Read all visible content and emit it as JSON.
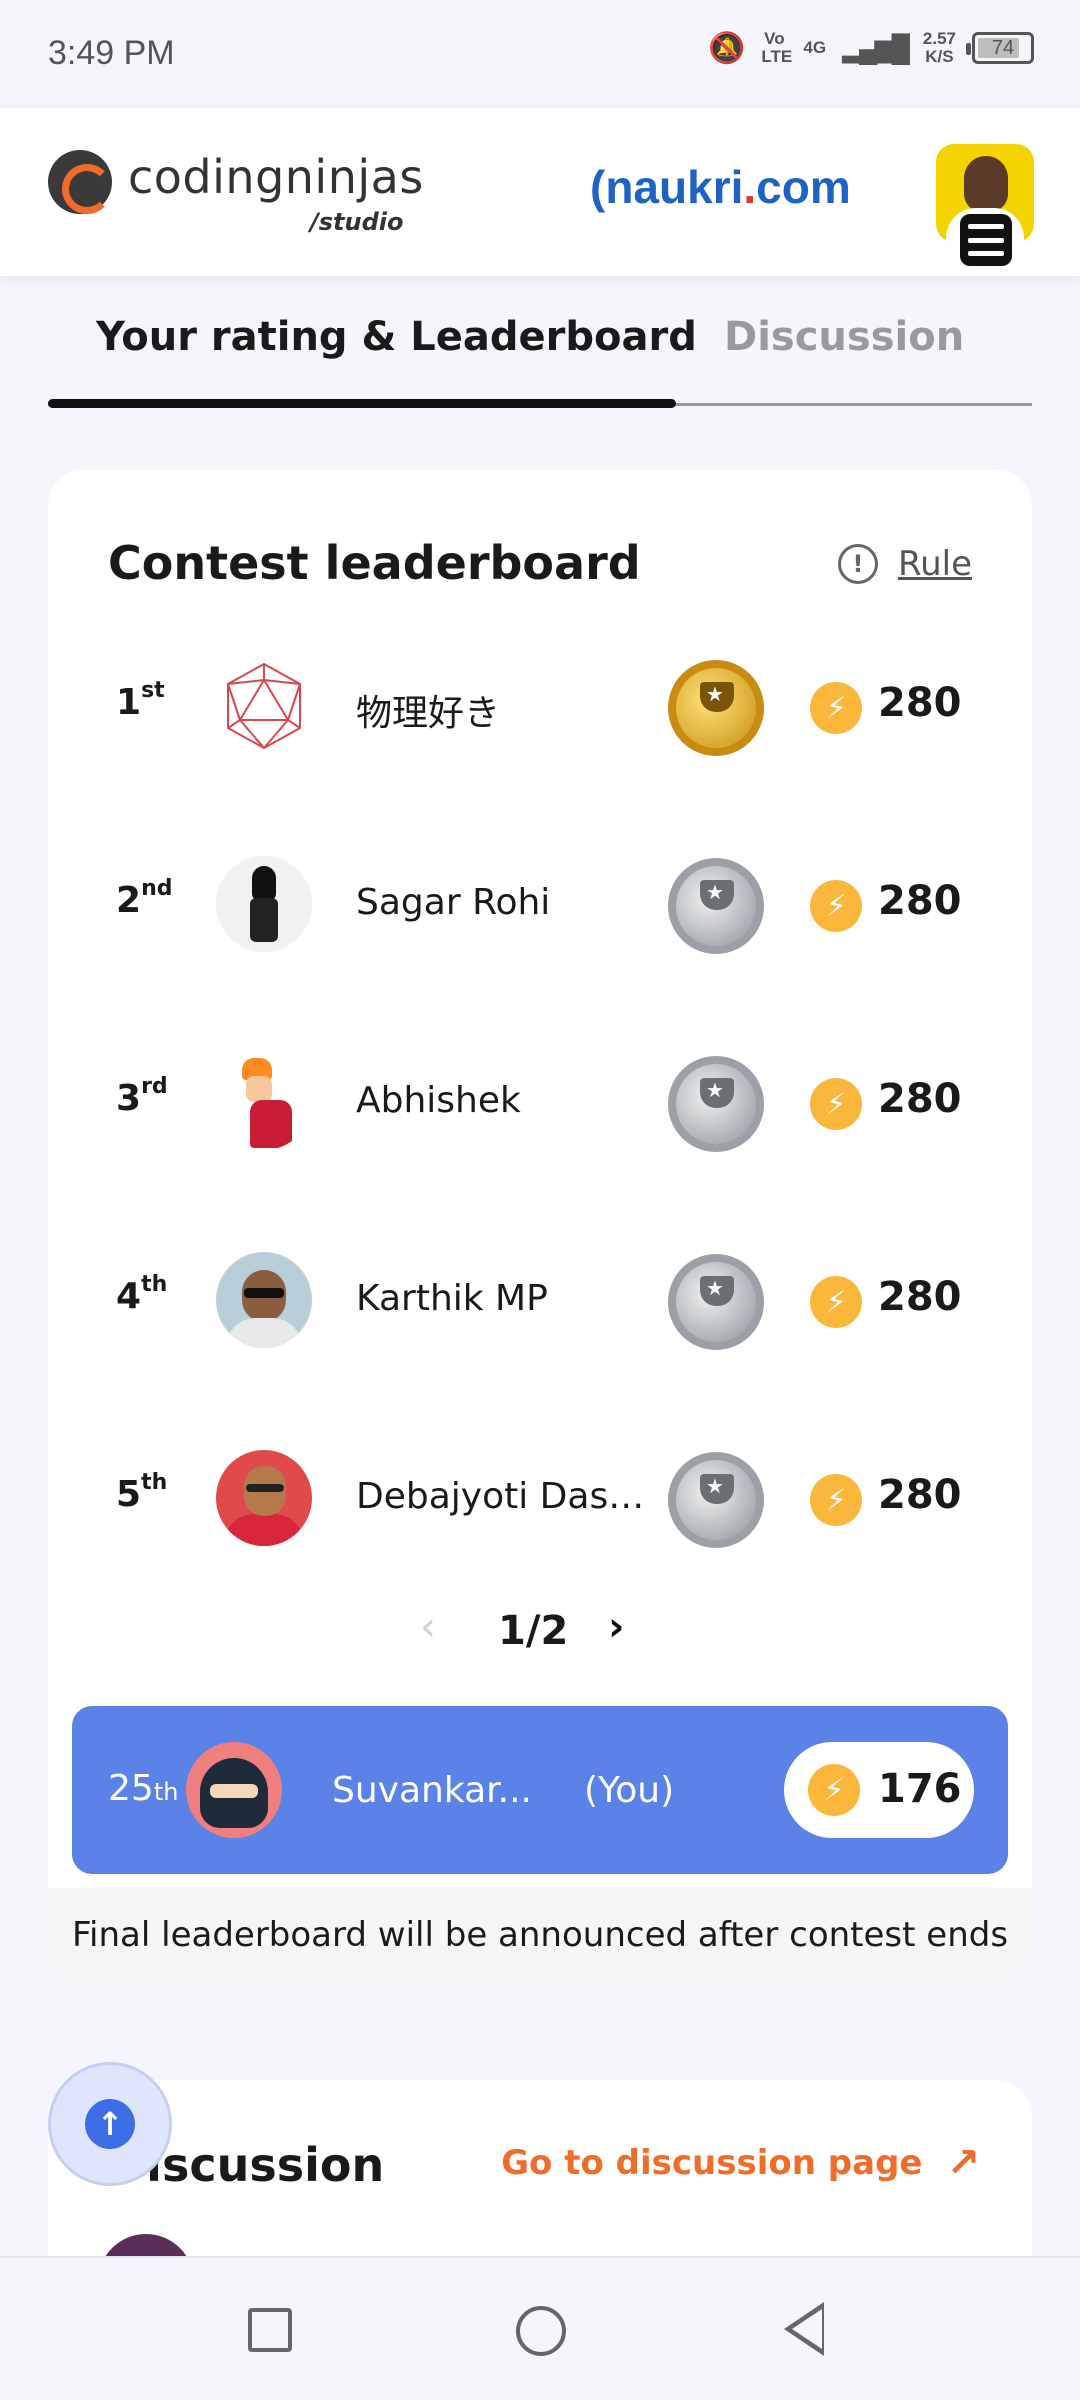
{
  "status_bar": {
    "time": "3:49 PM",
    "network_lte": "Vo LTE",
    "network_4g": "4G",
    "speed_value": "2.57",
    "speed_unit": "K/S",
    "battery": "74"
  },
  "header": {
    "brand_name_part1": "coding",
    "brand_name_part2": "ninjas",
    "brand_sub": "/studio",
    "partner_prefix": "naukri",
    "partner_dot": ".",
    "partner_suffix": "com"
  },
  "tabs": [
    {
      "label": "Your rating & Leaderboard",
      "active": true
    },
    {
      "label": "Discussion",
      "active": false
    }
  ],
  "leaderboard": {
    "title": "Contest leaderboard",
    "rule_label": "Rule",
    "rows": [
      {
        "rank_num": "1",
        "rank_suffix": "st",
        "name": "物理好き",
        "trophy": "gold",
        "score": "280"
      },
      {
        "rank_num": "2",
        "rank_suffix": "nd",
        "name": "Sagar Rohi",
        "trophy": "silver",
        "score": "280"
      },
      {
        "rank_num": "3",
        "rank_suffix": "rd",
        "name": "Abhishek",
        "trophy": "silver",
        "score": "280"
      },
      {
        "rank_num": "4",
        "rank_suffix": "th",
        "name": "Karthik MP",
        "trophy": "silver",
        "score": "280"
      },
      {
        "rank_num": "5",
        "rank_suffix": "th",
        "name": "Debajyoti Dasg...",
        "trophy": "silver",
        "score": "280"
      }
    ],
    "pagination": "1/2",
    "my_entry": {
      "rank_num": "25",
      "rank_suffix": "th",
      "name": "Suvankar...",
      "you_label": "(You)",
      "score": "176"
    },
    "final_note": "Final leaderboard will be announced after contest ends"
  },
  "discussion": {
    "title": "Discussion",
    "link_label": "Go to discussion page"
  },
  "colors": {
    "accent_orange": "#ef6c2b",
    "my_row_blue": "#5b82e6",
    "coin_yellow": "#fbb73b"
  }
}
